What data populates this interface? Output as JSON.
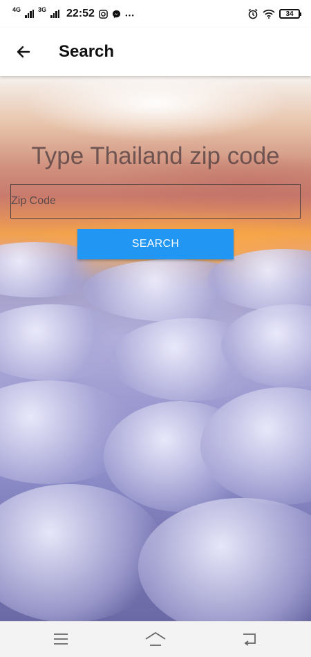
{
  "status_bar": {
    "network_1": "4G",
    "network_2": "3G",
    "time": "22:52",
    "battery_level": "34",
    "icons": [
      "signal-icon",
      "instagram-icon",
      "messenger-icon",
      "more-icon",
      "alarm-icon",
      "wifi-icon",
      "battery-icon"
    ]
  },
  "app_bar": {
    "title": "Search",
    "back_icon": "arrow-left-icon"
  },
  "main": {
    "headline": "Type Thailand zip code",
    "zip_input": {
      "placeholder": "Zip Code",
      "value": ""
    },
    "search_button_label": "SEARCH",
    "search_button_color": "#2196f3"
  },
  "nav_bar": {
    "icons": [
      "menu-icon",
      "home-icon",
      "back-icon"
    ]
  }
}
